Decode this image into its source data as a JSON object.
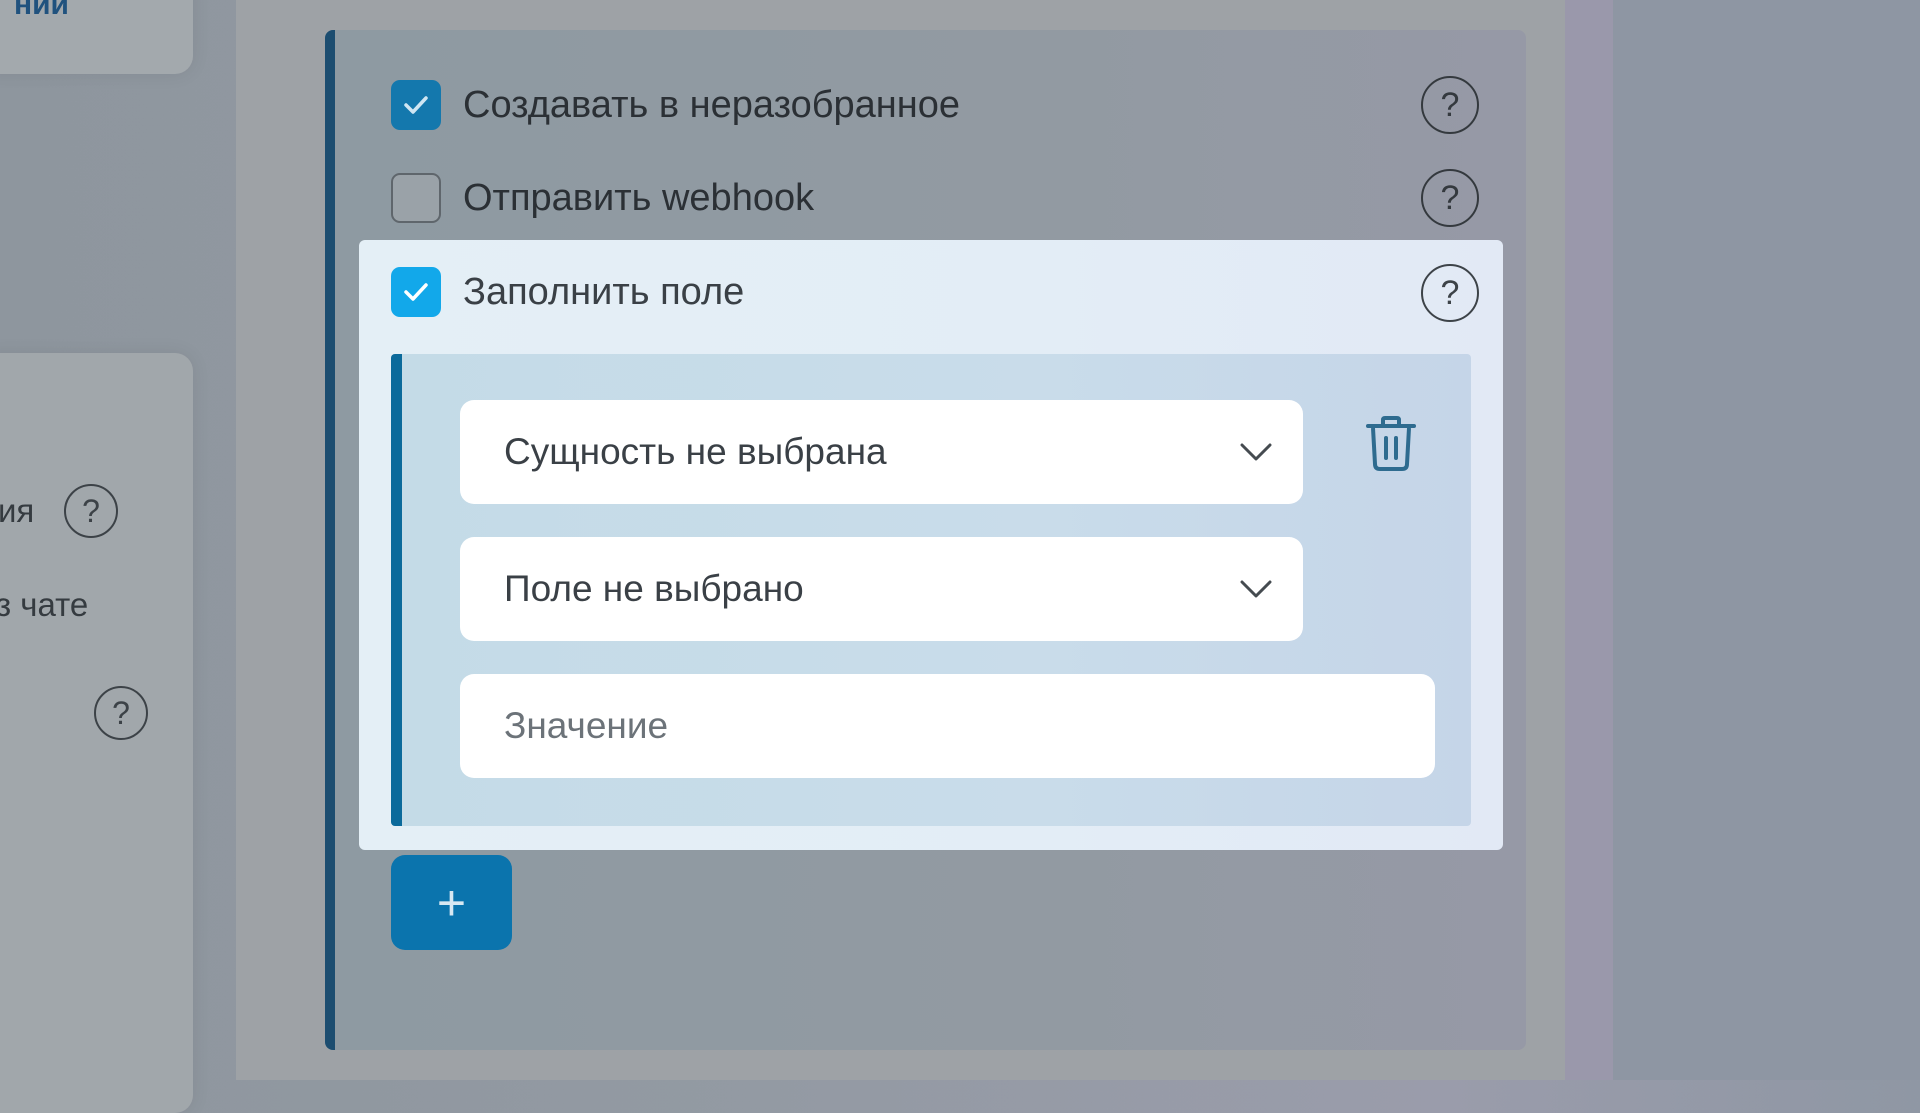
{
  "left": {
    "top_card_title": "ний",
    "line1": "ия",
    "line2": "з чате"
  },
  "options": [
    {
      "label": "Создавать в неразобранное",
      "checked": true
    },
    {
      "label": "Отправить webhook",
      "checked": false
    },
    {
      "label": "Заполнить поле",
      "checked": true
    }
  ],
  "fill_field": {
    "entity_select": "Сущность не выбрана",
    "field_select": "Поле не выбрано",
    "value_placeholder": "Значение"
  },
  "help_glyph": "?",
  "add_label": "+",
  "colors": {
    "accent": "#1c4d70",
    "checkbox_active": "#12a8ea",
    "add_button": "#0b74ad"
  }
}
